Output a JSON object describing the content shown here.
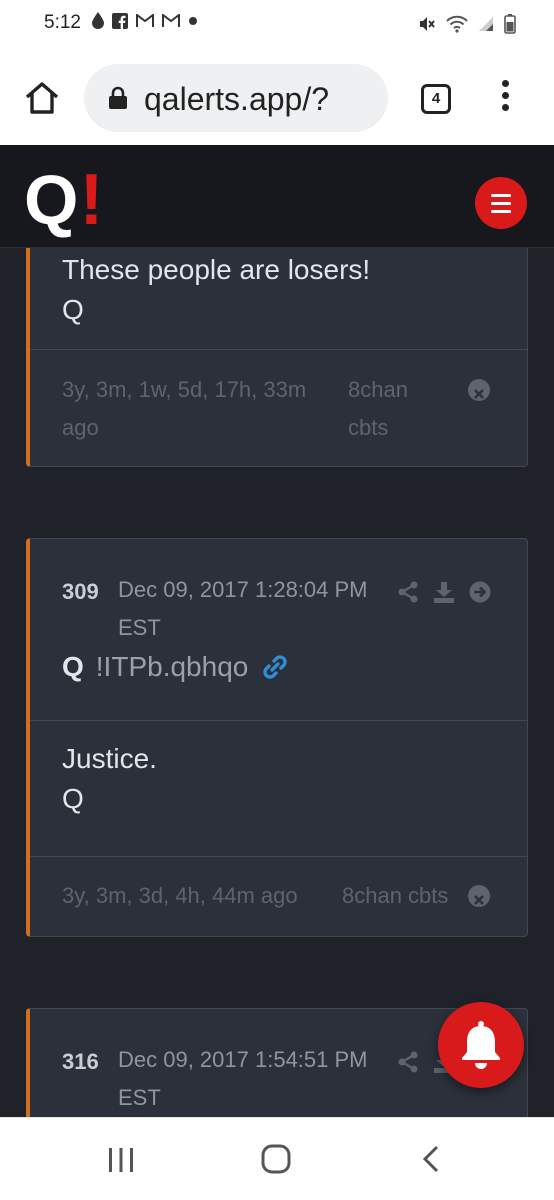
{
  "status_bar": {
    "time": "5:12"
  },
  "browser": {
    "url": "qalerts.app/?",
    "tab_count": "4"
  },
  "site": {
    "logo_letter": "Q",
    "logo_mark": "!"
  },
  "posts": [
    {
      "body_lines": [
        "These people are losers!",
        "Q"
      ],
      "age": "3y, 3m, 1w, 5d, 17h, 33m ago",
      "source": "8chan cbts"
    },
    {
      "number": "309",
      "date": "Dec 09, 2017 1:28:04 PM EST",
      "author": "Q",
      "tripcode": "!ITPb.qbhqo",
      "body_lines": [
        "Justice.",
        "Q"
      ],
      "age": "3y, 3m, 3d, 4h, 44m ago",
      "source": "8chan cbts"
    },
    {
      "number": "316",
      "date": "Dec 09, 2017 1:54:51 PM EST"
    }
  ],
  "colors": {
    "accent": "#d91a1a",
    "post_border": "#d0701e",
    "link": "#2e8fd6"
  }
}
